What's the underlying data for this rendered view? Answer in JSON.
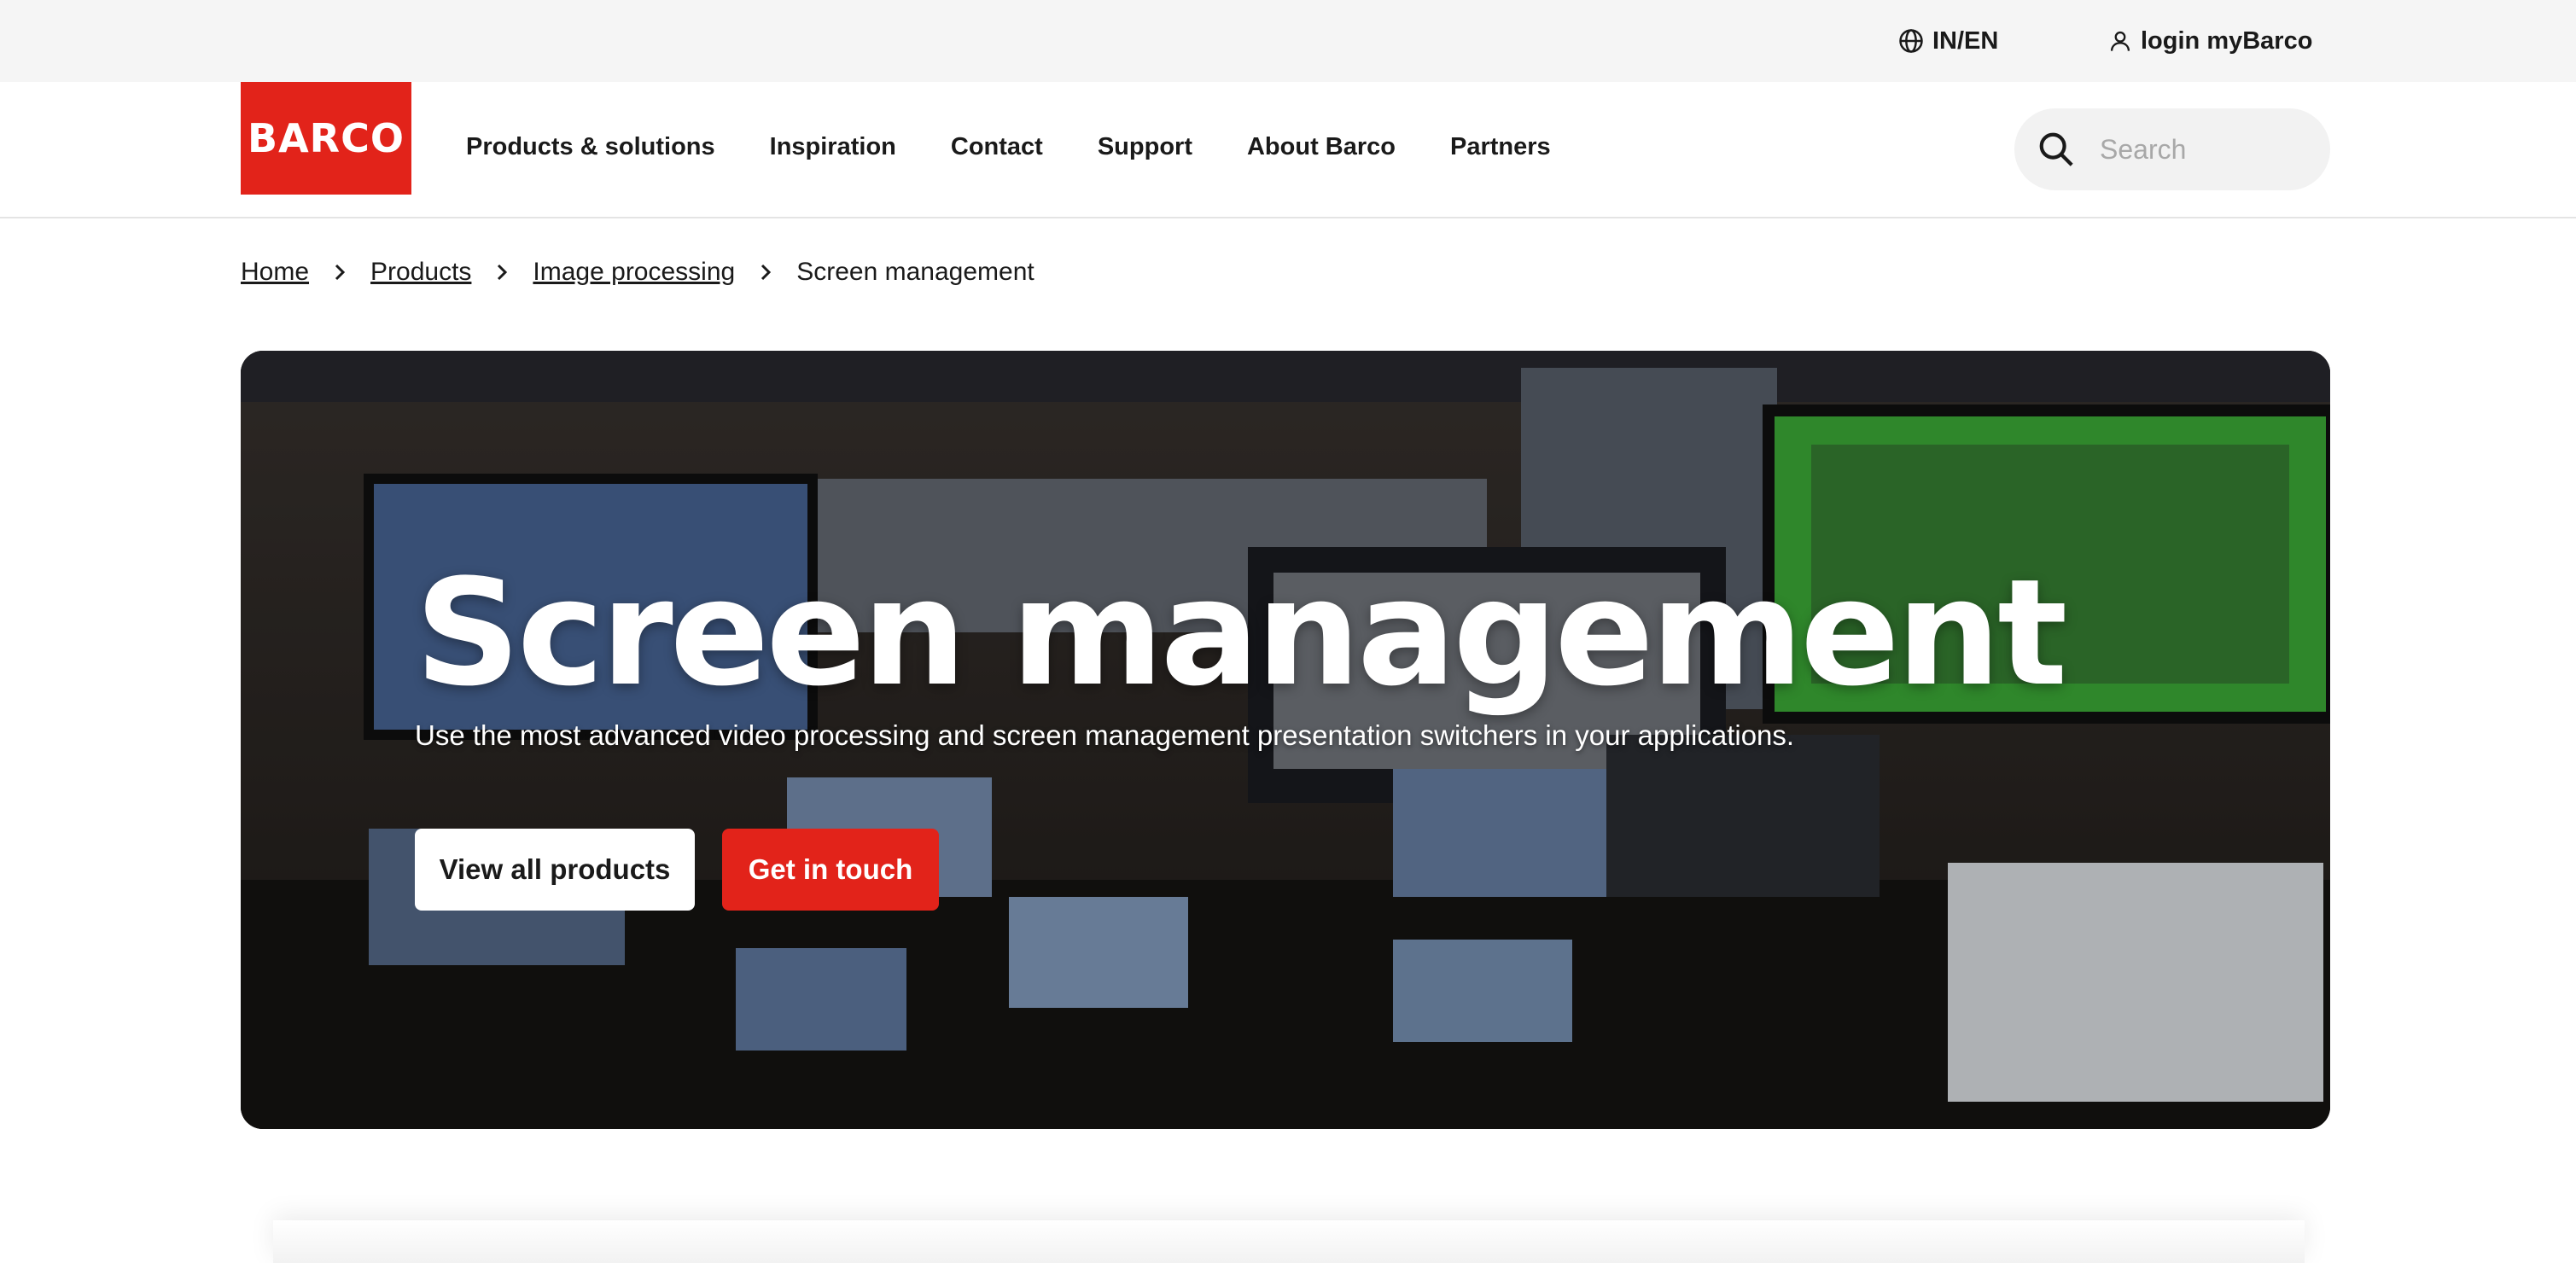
{
  "utility": {
    "language": "IN/EN",
    "login": "login myBarco"
  },
  "brand": {
    "logo_text": "BARCO",
    "color": "#e2231a"
  },
  "nav": {
    "items": [
      "Products & solutions",
      "Inspiration",
      "Contact",
      "Support",
      "About Barco",
      "Partners"
    ]
  },
  "search": {
    "placeholder": "Search"
  },
  "breadcrumb": {
    "items": [
      "Home",
      "Products",
      "Image processing"
    ],
    "current": "Screen management"
  },
  "hero": {
    "title": "Screen management",
    "subtitle": "Use the most advanced video processing and screen management presentation switchers in your applications.",
    "primary_button": "View all products",
    "secondary_button": "Get in touch"
  },
  "icons": [
    "globe-icon",
    "user-icon",
    "search-icon",
    "chevron-right-icon"
  ]
}
